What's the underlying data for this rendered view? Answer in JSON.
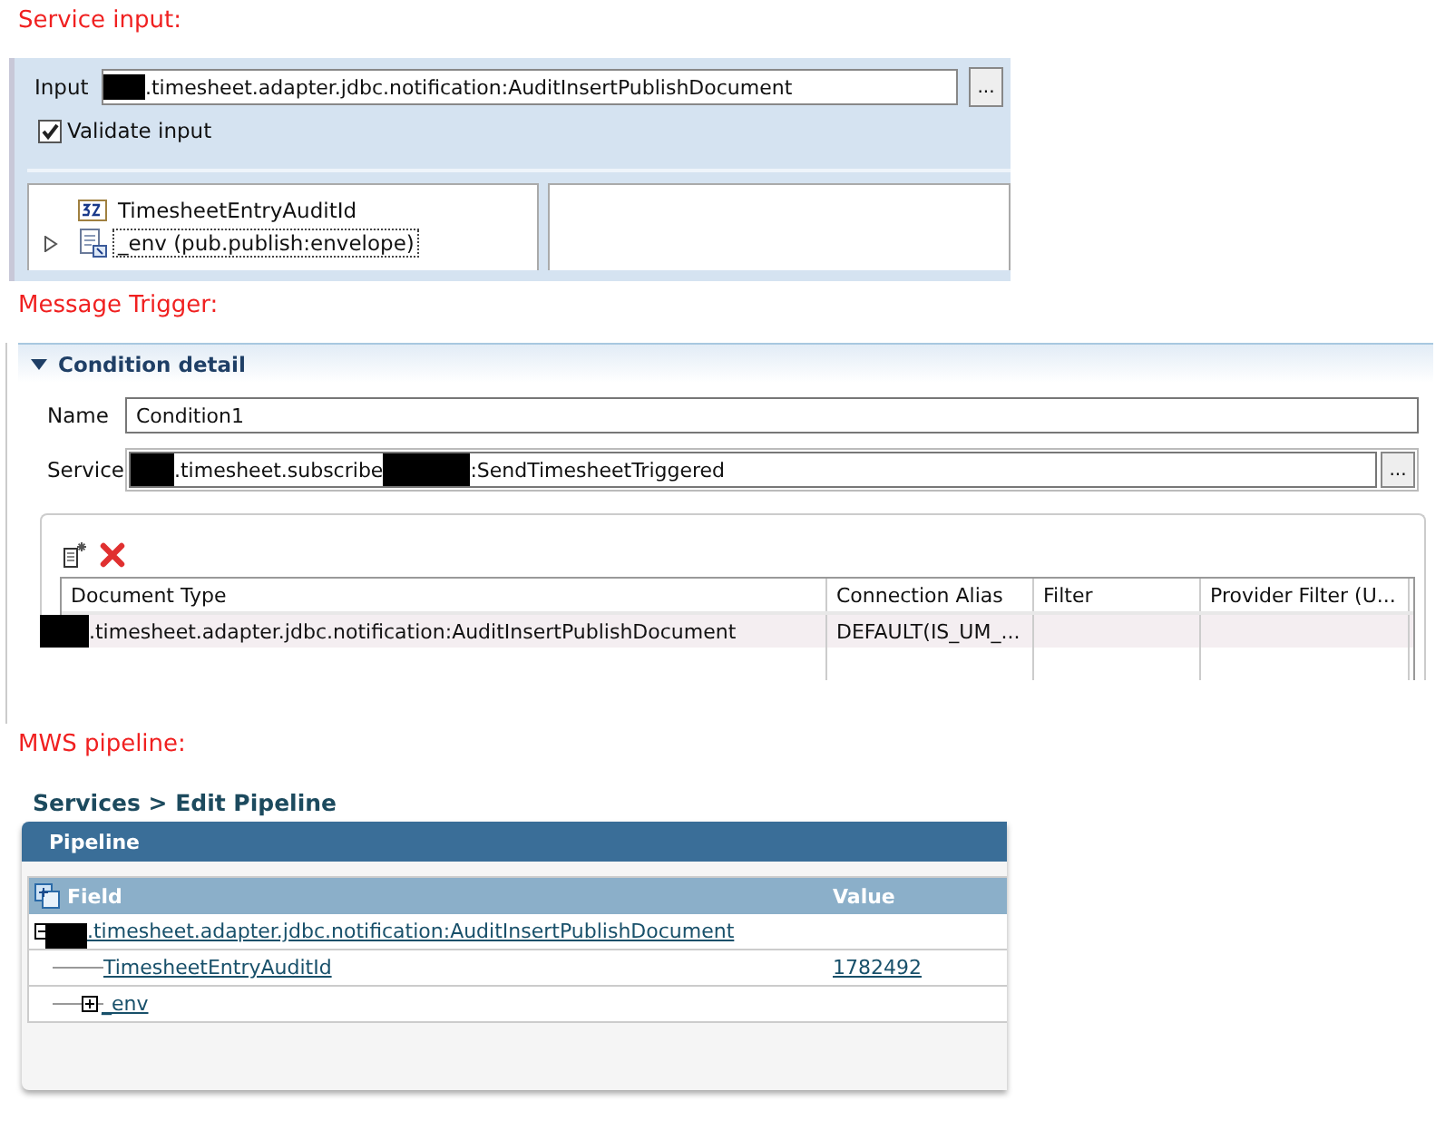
{
  "service_input": {
    "heading": "Service input:",
    "input_label": "Input",
    "input_value": ".timesheet.adapter.jdbc.notification:AuditInsertPublishDocument",
    "browse_button": "...",
    "validate": {
      "label": "Validate input",
      "checked": true
    },
    "tree": [
      {
        "label": "TimesheetEntryAuditId",
        "kind": "integer"
      },
      {
        "label": "_env (pub.publish:envelope)",
        "kind": "document",
        "expanded": false,
        "selected": true
      }
    ]
  },
  "message_trigger": {
    "heading": "Message Trigger:",
    "section": {
      "title": "Condition detail",
      "expanded": true
    },
    "name_label": "Name",
    "name_value": "Condition1",
    "service_label": "Service",
    "service_value_parts": [
      ".timesheet.subscribe",
      ":SendTimesheetTriggered"
    ],
    "browse_button": "...",
    "table": {
      "columns": [
        "Document Type",
        "Connection Alias",
        "Filter",
        "Provider Filter (U..."
      ],
      "rows": [
        {
          "cells": [
            ".timesheet.adapter.jdbc.notification:AuditInsertPublishDocument",
            "DEFAULT(IS_UM_..."
          ],
          "selected": true
        }
      ]
    }
  },
  "mws_pipeline": {
    "heading": "MWS pipeline:",
    "breadcrumb": "Services > Edit Pipeline",
    "panel_title": "Pipeline",
    "columns": [
      "Field",
      "Value"
    ],
    "rows": [
      {
        "field": ".timesheet.adapter.jdbc.notification:AuditInsertPublishDocument",
        "expanded": true,
        "children": [
          {
            "field": "TimesheetEntryAuditId",
            "value": "1782492"
          },
          {
            "field": "_env",
            "expanded": false
          }
        ]
      }
    ]
  }
}
